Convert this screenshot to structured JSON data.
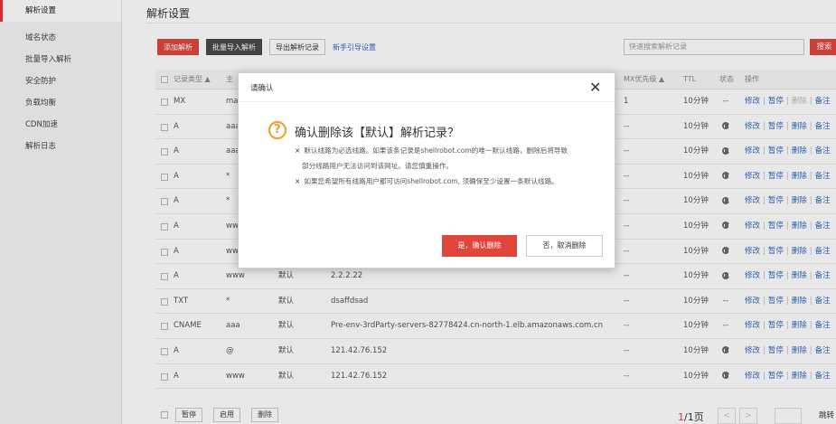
{
  "sidebar": {
    "items": [
      {
        "label": "解析设置"
      },
      {
        "label": "域名状态"
      },
      {
        "label": "批量导入解析"
      },
      {
        "label": "安全防护"
      },
      {
        "label": "负载均衡"
      },
      {
        "label": "CDN加速"
      },
      {
        "label": "解析日志"
      }
    ]
  },
  "main": {
    "title": "解析设置",
    "toolbar": {
      "add_label": "添加解析",
      "import_label": "批量导入解析",
      "export_label": "导出解析记录",
      "guide_link": "新手引导设置"
    },
    "search": {
      "placeholder": "快速搜索解析记录",
      "button_label": "搜索"
    },
    "table": {
      "headers": {
        "type": "记录类型 ▲",
        "host": "主",
        "mx": "MX优先级 ▲",
        "ttl": "TTL",
        "status": "状态",
        "ops": "操作"
      },
      "op_labels": {
        "edit": "修改",
        "pause": "暂停",
        "delete": "删除",
        "remark": "备注"
      },
      "rows": [
        {
          "type": "MX",
          "host": "ma",
          "line": "",
          "value": "",
          "mx": "1",
          "ttl": "10分钟",
          "status": "--"
        },
        {
          "type": "A",
          "host": "aaa",
          "line": "",
          "value": "",
          "mx": "--",
          "ttl": "10分钟",
          "status": "pause-icon"
        },
        {
          "type": "A",
          "host": "aaa",
          "line": "",
          "value": "",
          "mx": "--",
          "ttl": "10分钟",
          "status": "pause-icon"
        },
        {
          "type": "A",
          "host": "*",
          "line": "",
          "value": "",
          "mx": "--",
          "ttl": "10分钟",
          "status": "pause-icon"
        },
        {
          "type": "A",
          "host": "*",
          "line": "",
          "value": "",
          "mx": "--",
          "ttl": "10分钟",
          "status": "pause-icon"
        },
        {
          "type": "A",
          "host": "ww",
          "line": "",
          "value": "",
          "mx": "--",
          "ttl": "10分钟",
          "status": "pause-icon"
        },
        {
          "type": "A",
          "host": "ww",
          "line": "",
          "value": "",
          "mx": "--",
          "ttl": "10分钟",
          "status": "pause-icon"
        },
        {
          "type": "A",
          "host": "www",
          "line": "默认",
          "value": "2.2.2.22",
          "mx": "--",
          "ttl": "10分钟",
          "status": "pause-icon"
        },
        {
          "type": "TXT",
          "host": "*",
          "line": "默认",
          "value": "dsaffdsad",
          "mx": "--",
          "ttl": "10分钟",
          "status": "--"
        },
        {
          "type": "CNAME",
          "host": "aaa",
          "line": "默认",
          "value": "Pre-env-3rdParty-servers-82778424.cn-north-1.elb.amazonaws.com.cn",
          "mx": "--",
          "ttl": "10分钟",
          "status": "--"
        },
        {
          "type": "A",
          "host": "@",
          "line": "默认",
          "value": "121.42.76.152",
          "mx": "--",
          "ttl": "10分钟",
          "status": "pause-icon"
        },
        {
          "type": "A",
          "host": "www",
          "line": "默认",
          "value": "121.42.76.152",
          "mx": "--",
          "ttl": "10分钟",
          "status": "pause-icon"
        }
      ]
    },
    "bottom": {
      "pause_label": "暂停",
      "enable_label": "启用",
      "delete_label": "删除",
      "page_current": "1",
      "page_total": "/1页",
      "prev": "<",
      "next": ">",
      "jump_label": "跳转"
    }
  },
  "dialog": {
    "title": "请确认",
    "close": "✕",
    "heading": "确认删除该【默认】解析记录？",
    "lines": [
      "默认线路为必选线路。如果该条记录是shellrobot.com的唯一默认线路，删除后将导致",
      "部分线路用户无法访问到该网址。请您慎重操作。",
      "如果您希望所有线路用户都可访问shellrobot.com, 须确保至少设置一条默认线路。"
    ],
    "bullet": "×",
    "confirm_label": "是，确认删除",
    "cancel_label": "否，取消删除"
  },
  "colors": {
    "accent": "#e0463c",
    "link": "#2a6bc4",
    "warn": "#f39b25"
  }
}
